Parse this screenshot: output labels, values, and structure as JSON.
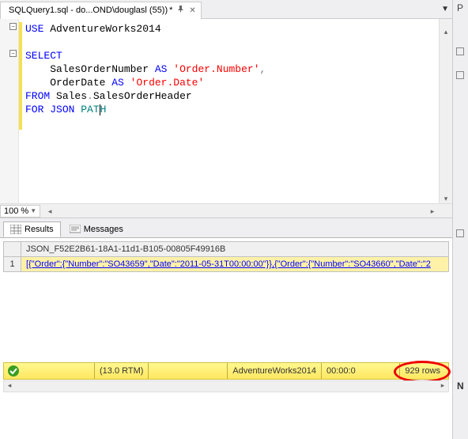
{
  "tab": {
    "title": "SQLQuery1.sql - do...OND\\douglasl (55))",
    "modified_marker": "*"
  },
  "zoom": "100 %",
  "code": {
    "use_kw": "USE",
    "db": "AdventureWorks2014",
    "select_kw": "SELECT",
    "col1": "SalesOrderNumber",
    "as_kw": "AS",
    "alias1": "'Order.Number'",
    "col2": "OrderDate",
    "alias2": "'Order.Date'",
    "from_kw": "FROM",
    "schema": "Sales",
    "table": "SalesOrderHeader",
    "for_kw": "FOR",
    "json_kw": "JSON",
    "path_ident": "PAT",
    "path_rest": "H"
  },
  "results": {
    "tabs": {
      "results": "Results",
      "messages": "Messages"
    },
    "column_header": "JSON_F52E2B61-18A1-11d1-B105-00805F49916B",
    "row_num": "1",
    "cell_value": "[{\"Order\":{\"Number\":\"SO43659\",\"Date\":\"2011-05-31T00:00:00\"}},{\"Order\":{\"Number\":\"SO43660\",\"Date\":\"2"
  },
  "status": {
    "version": "(13.0 RTM)",
    "database": "AdventureWorks2014",
    "elapsed": "00:00:0",
    "rows": "929 rows"
  },
  "right_panel": {
    "header_letter": "P"
  }
}
